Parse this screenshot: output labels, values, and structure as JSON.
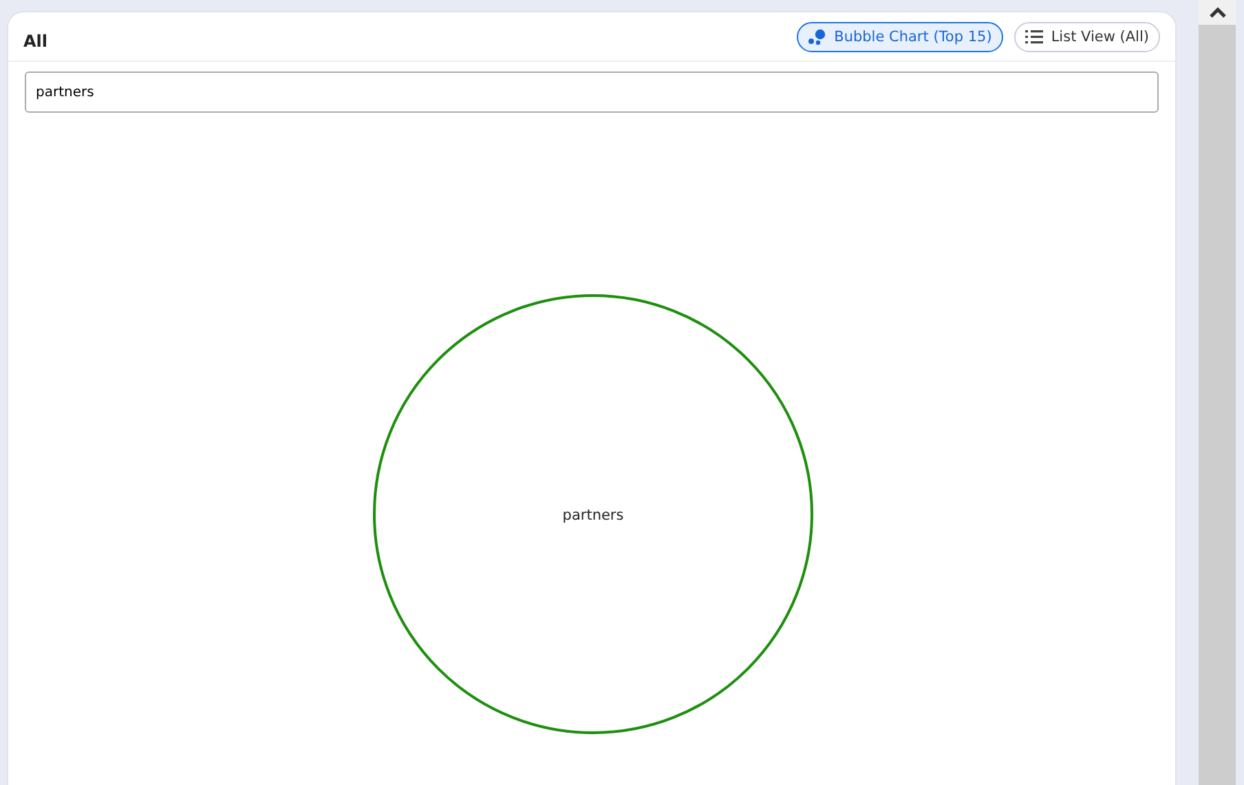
{
  "panel": {
    "title": "All"
  },
  "views": [
    {
      "kind": "bubble",
      "label": "Bubble Chart (Top 15)",
      "selected": true
    },
    {
      "kind": "list",
      "label": "List View (All)",
      "selected": false
    }
  ],
  "search": {
    "value": "partners"
  },
  "bubbles": [
    {
      "label": "partners",
      "color": "#1e8f0e"
    }
  ]
}
